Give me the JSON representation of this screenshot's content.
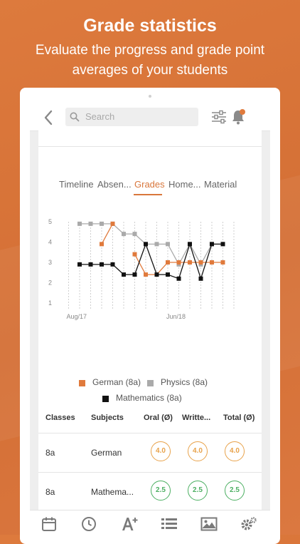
{
  "promo": {
    "title": "Grade statistics",
    "subtitle": "Evaluate the progress and grade point averages of your students"
  },
  "toolbar": {
    "search_placeholder": "Search",
    "icons": [
      "back-chevron-icon",
      "search-icon",
      "filter-sliders-icon",
      "bell-icon"
    ],
    "notification_dot_color": "#e07a3c"
  },
  "tabs": [
    {
      "label": "Timeline",
      "active": false
    },
    {
      "label": "Absen...",
      "active": false
    },
    {
      "label": "Grades",
      "active": true
    },
    {
      "label": "Home...",
      "active": false
    },
    {
      "label": "Material",
      "active": false
    }
  ],
  "chart_data": {
    "type": "line",
    "x_tick_labels": [
      "Aug/17",
      "Jun/18"
    ],
    "y_ticks": [
      1,
      2,
      3,
      4,
      5
    ],
    "ylim": [
      1,
      5
    ],
    "grid": "vertical dotted",
    "legend_position": "bottom",
    "series": [
      {
        "name": "German (8a)",
        "color": "#e07a3c",
        "values": [
          null,
          null,
          3.9,
          4.9,
          null,
          3.4,
          2.4,
          2.4,
          3.0,
          3.0,
          3.0,
          3.0,
          3.0,
          3.0
        ]
      },
      {
        "name": "Physics (8a)",
        "color": "#aaaaaa",
        "values": [
          4.9,
          4.9,
          4.9,
          4.9,
          4.4,
          4.4,
          3.9,
          3.9,
          3.9,
          2.9,
          3.9,
          2.9,
          3.9,
          3.9
        ]
      },
      {
        "name": "Mathematics (8a)",
        "color": "#111111",
        "values": [
          2.9,
          2.9,
          2.9,
          2.9,
          2.4,
          2.4,
          3.9,
          2.4,
          2.4,
          2.2,
          3.9,
          2.2,
          3.9,
          3.9
        ]
      }
    ]
  },
  "table": {
    "headers": [
      "Classes",
      "Subjects",
      "Oral (Ø)",
      "Writte...",
      "Total (Ø)"
    ],
    "rows": [
      {
        "class": "8a",
        "subject": "German",
        "oral": "4.0",
        "written": "4.0",
        "total": "4.0",
        "tone": "orange"
      },
      {
        "class": "8a",
        "subject": "Mathema...",
        "oral": "2.5",
        "written": "2.5",
        "total": "2.5",
        "tone": "green"
      }
    ]
  },
  "bottom_nav": [
    "calendar-icon",
    "clock-icon",
    "grade-a-plus-icon",
    "list-icon",
    "image-icon",
    "settings-gears-icon"
  ]
}
